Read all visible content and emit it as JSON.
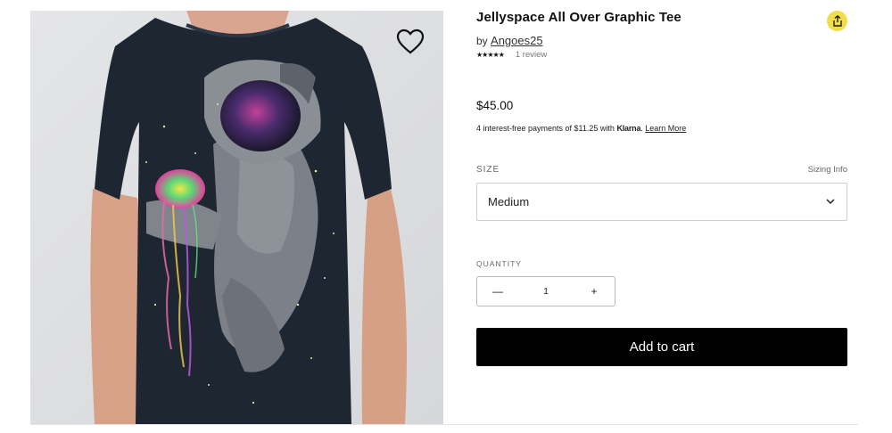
{
  "product": {
    "title": "Jellyspace All Over Graphic Tee",
    "by_prefix": "by",
    "artist": "Angoes25",
    "stars": "★★★★★",
    "review_count": "1 review",
    "price": "$45.00",
    "klarna": {
      "prefix": "4 interest-free payments of $11.25 with",
      "brand": "Klarna",
      "dot": ".",
      "learn_more": "Learn More"
    }
  },
  "size": {
    "label": "SIZE",
    "info_link": "Sizing Info",
    "selected": "Medium"
  },
  "quantity": {
    "label": "QUANTITY",
    "value": "1",
    "minus": "—",
    "plus": "+"
  },
  "add_to_cart": "Add to cart",
  "icons": {
    "favorite": "heart-icon",
    "share": "share-icon",
    "dropdown": "chevron-down-icon"
  },
  "colors": {
    "share_bg": "#f2dd4a",
    "cart_bg": "#000000",
    "shirt": "#1e2632"
  }
}
